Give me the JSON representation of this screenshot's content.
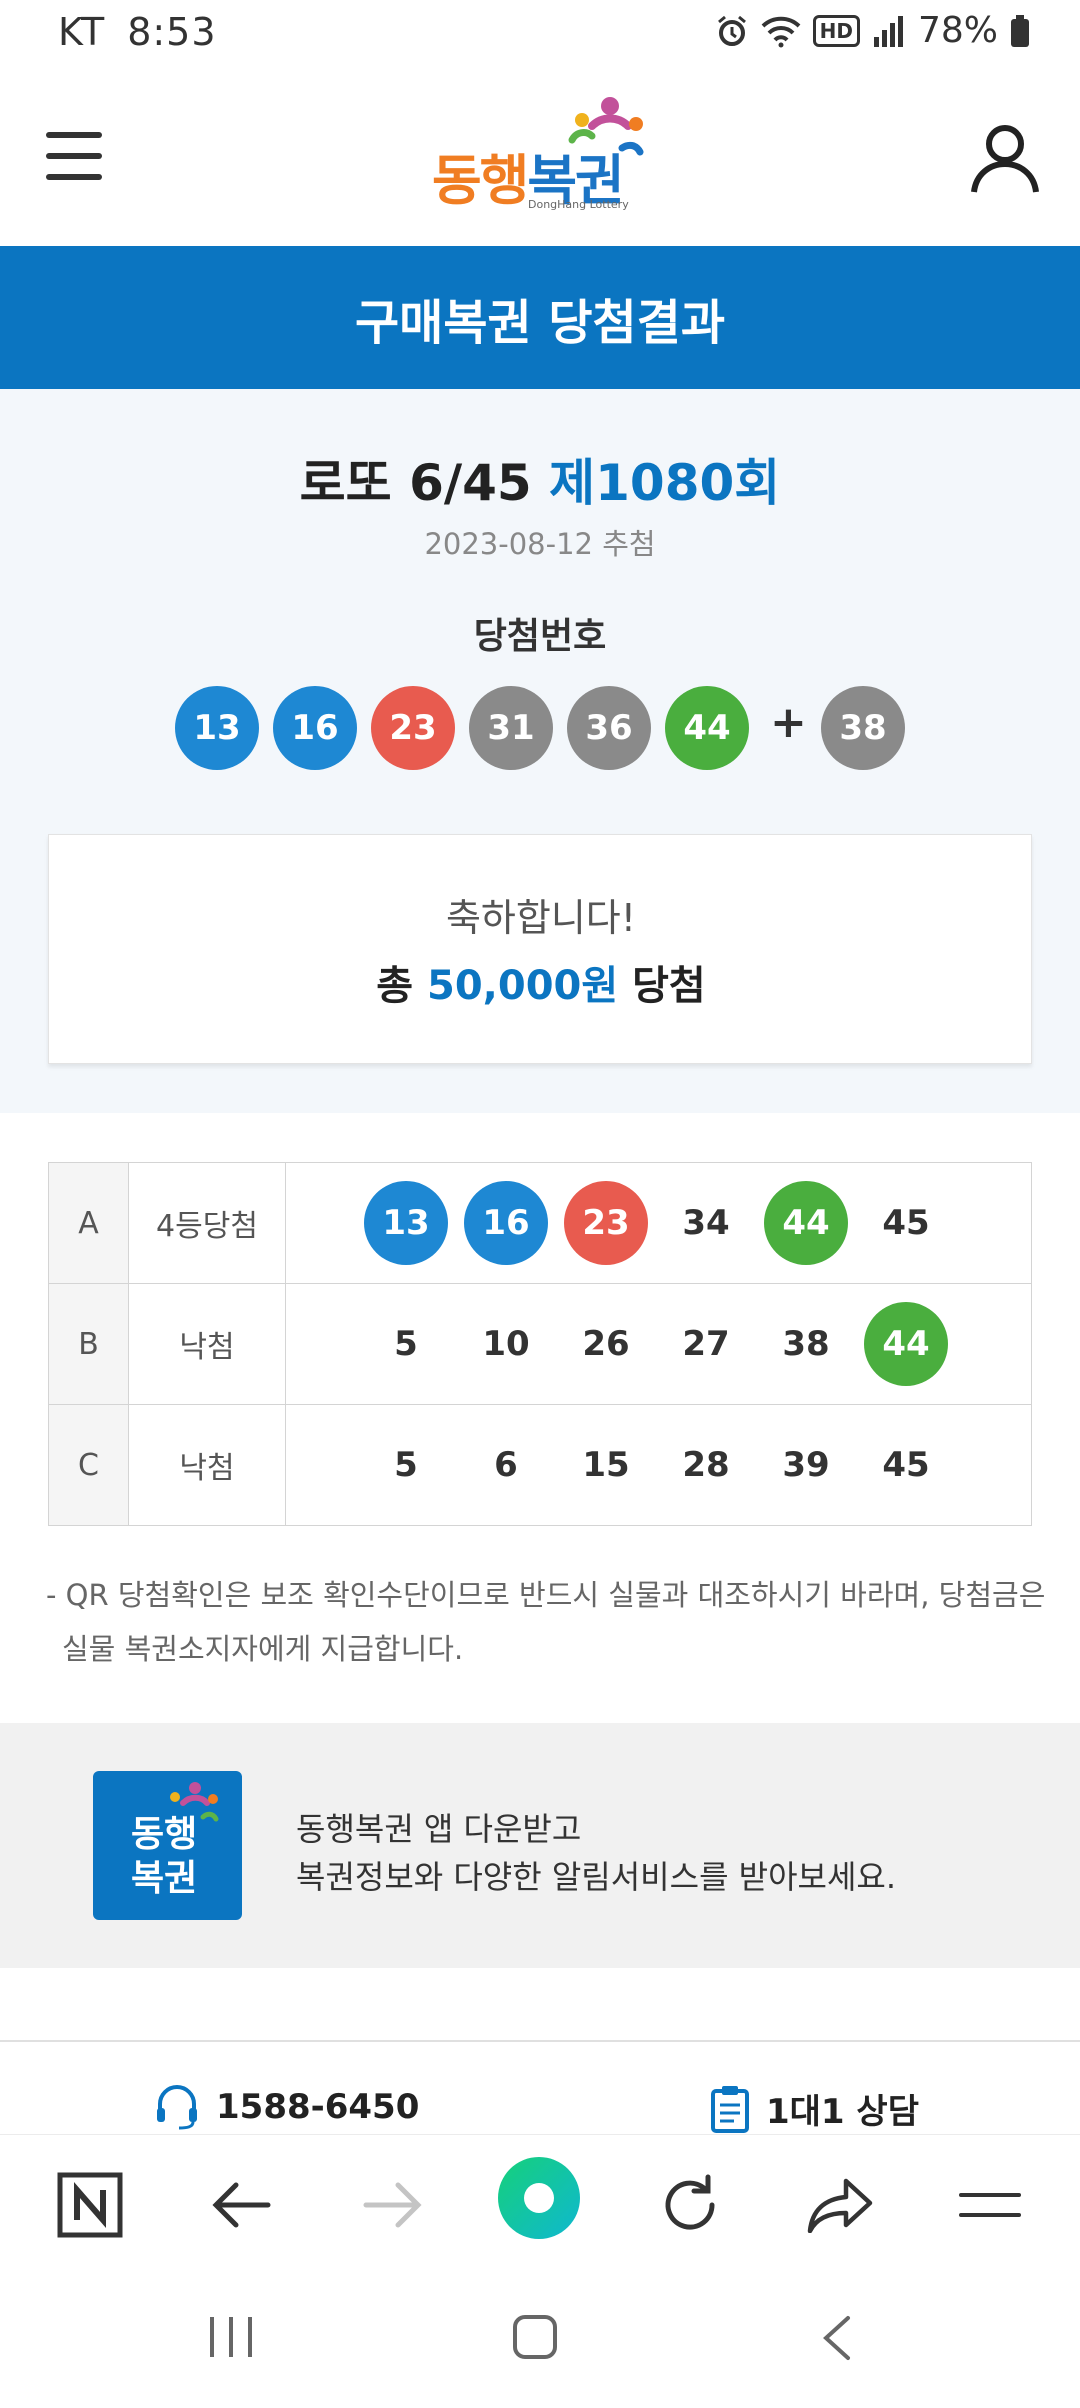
{
  "status_bar": {
    "carrier": "KT",
    "time": "8:53",
    "battery": "78%",
    "hd_label": "HD"
  },
  "header": {
    "logo_text_part1": "동행",
    "logo_text_part2": "복권",
    "logo_sub": "DongHang Lottery"
  },
  "page_title": "구매복권 당첨결과",
  "draw": {
    "game": "로또 6/45",
    "round": "제1080회",
    "date": "2023-08-12 추첨",
    "label": "당첨번호",
    "numbers": [
      "13",
      "16",
      "23",
      "31",
      "36",
      "44"
    ],
    "bonus": "38",
    "plus": "+"
  },
  "result": {
    "congrats": "축하합니다!",
    "total_prefix": "총",
    "amount": "50,000원",
    "total_suffix": "당첨"
  },
  "tickets": [
    {
      "line": "A",
      "result": "4등당첨",
      "numbers": [
        "13",
        "16",
        "23",
        "34",
        "44",
        "45"
      ]
    },
    {
      "line": "B",
      "result": "낙첨",
      "numbers": [
        "5",
        "10",
        "26",
        "27",
        "38",
        "44"
      ]
    },
    {
      "line": "C",
      "result": "낙첨",
      "numbers": [
        "5",
        "6",
        "15",
        "28",
        "39",
        "45"
      ]
    }
  ],
  "notice": {
    "line1": "- QR 당첨확인은 보조 확인수단이므로 반드시 실물과 대조하시기 바라며, 당첨금은",
    "line2": "실물 복권소지자에게 지급합니다."
  },
  "app_banner": {
    "icon_line1": "동행",
    "icon_line2": "복권",
    "line1": "동행복권 앱 다운받고",
    "line2": "복권정보와 다양한 알림서비스를 받아보세요."
  },
  "contacts": {
    "phone": "1588-6450",
    "consult": "1대1 상담"
  },
  "colors": {
    "brand_blue": "#0b75c1",
    "ball_blue": "#1e88d3",
    "ball_red": "#e85b4f",
    "ball_gray": "#8a8a8a",
    "ball_green": "#4aae3e",
    "logo_orange": "#f07d22"
  },
  "icons": [
    "menu-icon",
    "user-icon",
    "headset-icon",
    "clipboard-icon",
    "naver-icon",
    "back-icon",
    "forward-icon",
    "green-dot-icon",
    "refresh-icon",
    "share-icon",
    "browser-menu-icon"
  ]
}
